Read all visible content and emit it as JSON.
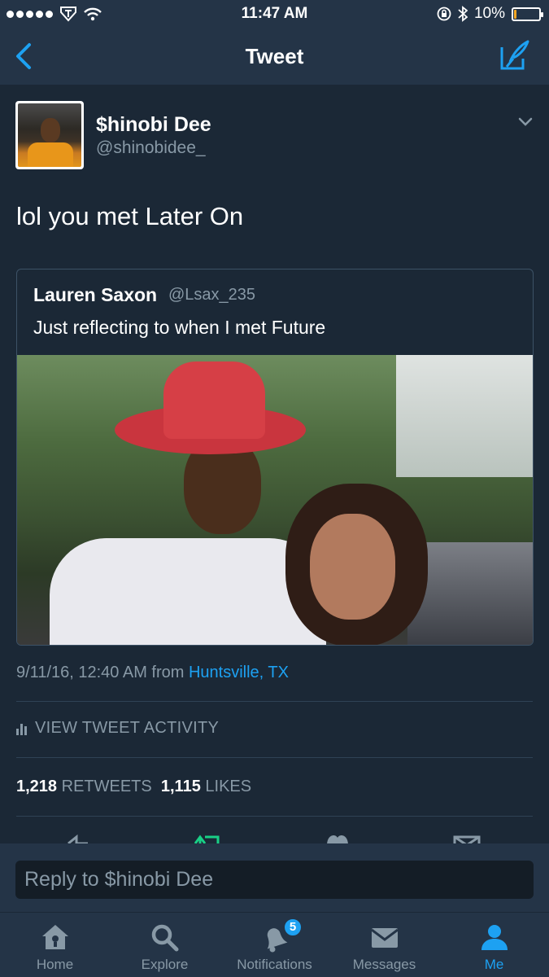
{
  "status_bar": {
    "time": "11:47 AM",
    "battery": "10%",
    "battery_level": 0.1
  },
  "nav": {
    "title": "Tweet"
  },
  "tweet": {
    "author_name": "$hinobi Dee",
    "author_handle": "@shinobidee_",
    "text": "lol you met Later On",
    "quoted": {
      "author_name": "Lauren Saxon",
      "author_handle": "@Lsax_235",
      "text": "Just reflecting to when I met Future"
    },
    "timestamp": "9/11/16, 12:40 AM from",
    "location": "Huntsville, TX",
    "activity_label": "VIEW TWEET ACTIVITY",
    "retweets_count": "1,218",
    "retweets_label": "RETWEETS",
    "likes_count": "1,115",
    "likes_label": "LIKES"
  },
  "reply": {
    "placeholder": "Reply to $hinobi Dee"
  },
  "tabs": [
    {
      "label": "Home",
      "icon": "home-icon"
    },
    {
      "label": "Explore",
      "icon": "search-icon"
    },
    {
      "label": "Notifications",
      "icon": "bell-icon",
      "badge": "5"
    },
    {
      "label": "Messages",
      "icon": "envelope-icon"
    },
    {
      "label": "Me",
      "icon": "person-icon",
      "active": true
    }
  ],
  "colors": {
    "accent": "#1da1f2",
    "background": "#1b2836",
    "bar": "#243447",
    "muted": "#8899a6"
  }
}
